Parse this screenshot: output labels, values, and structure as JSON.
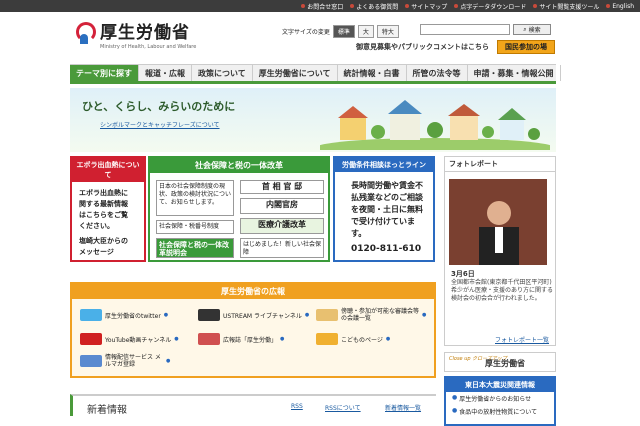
{
  "topbar": {
    "links": [
      "お問合せ窓口",
      "よくある御質問",
      "サイトマップ",
      "点字データダウンロード",
      "サイト閲覧支援ツール",
      "English"
    ]
  },
  "header": {
    "title": "厚生労働省",
    "subtitle": "Ministry of Health, Labour and Welfare"
  },
  "font_size": {
    "label": "文字サイズの変更",
    "options": [
      "標準",
      "大",
      "特大"
    ]
  },
  "search": {
    "button": "検索"
  },
  "feedback_text": "御意見募集やパブリックコメントはこちら",
  "kokumin_button": "国民参加の場",
  "nav": [
    "テーマ別に探す",
    "報道・広報",
    "政策について",
    "厚生労働省について",
    "統計情報・白書",
    "所管の法令等",
    "申請・募集・情報公開"
  ],
  "hero": {
    "title": "ひと、くらし、みらいのために",
    "link": "シンボルマークとキャッチフレーズについて"
  },
  "ebola": {
    "header": "エボラ出血熱について",
    "body": [
      "エボラ出血熱に",
      "関する最新情報",
      "はこちらをご覧",
      "ください。",
      "塩崎大臣からの",
      "メッセージ"
    ]
  },
  "shakai": {
    "header": "社会保障と税の一体改革",
    "cells": [
      "日本の社会保障制度の現状、政策の検討状況について、お知らせします。",
      "首 相 官 邸",
      "内閣官房",
      "社会保障・税番号制度",
      "医療介護改革",
      "社会保障と税の一体改革説明会",
      "はじめました！新しい社会保障"
    ]
  },
  "rodo": {
    "header": "労働条件相談ほっとライン",
    "body": [
      "長時間労働や賃金不",
      "払残業などのご相談",
      "を夜間・土日に無料",
      "で受け付けています。"
    ],
    "tel": "0120-811-610"
  },
  "koho": {
    "header": "厚生労働省の広報",
    "items": [
      "厚生労働省のtwitter",
      "USTREAM ライブチャンネル",
      "傍聴・参加が可能な審議会等の会議一覧",
      "YouTube動画チャンネル",
      "広報誌「厚生労働」",
      "こどものページ",
      "情報配信サービス メルマガ登録"
    ]
  },
  "shinchaku": {
    "title": "新着情報",
    "links": [
      "RSS",
      "RSSについて",
      "新着情報一覧"
    ]
  },
  "photo": {
    "header": "フォトレポート",
    "date": "3月6日",
    "text": "全国都市会館(東京都千代田区平河町)　　　　　　　　 希少がん医療・支援のあり方に関する検討会の初会合が行われました。",
    "more": "フォトレポート一覧"
  },
  "closeup": {
    "tag": "Close up クローズアップ",
    "title": "厚生労働省"
  },
  "shinsai": {
    "header": "東日本大震災関連情報",
    "items": [
      "厚生労働省からのお知らせ",
      "食品中の放射性物質について"
    ]
  }
}
